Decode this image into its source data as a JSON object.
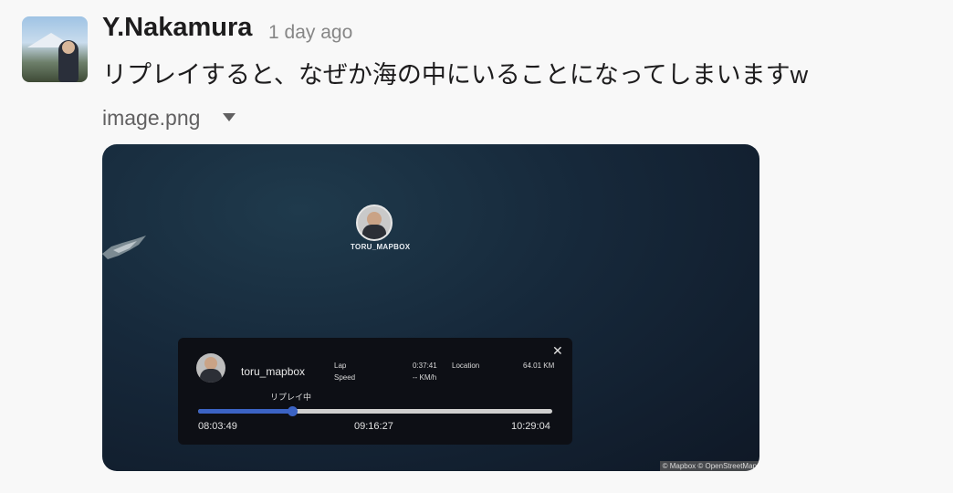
{
  "message": {
    "author": "Y.Nakamura",
    "timestamp": "1 day ago",
    "text": "リプレイすると、なぜか海の中にいることになってしまいますw",
    "attachment_name": "image.png"
  },
  "map": {
    "marker_label": "TORU_MAPBOX",
    "attribution": "© Mapbox © OpenStreetMap"
  },
  "replay_panel": {
    "username": "toru_mapbox",
    "lap_label": "Lap",
    "lap_value": "0:37:41",
    "location_label": "Location",
    "location_value": "64.01 KM",
    "speed_label": "Speed",
    "speed_value": "-- KM/h",
    "status": "リプレイ中",
    "start_time": "08:03:49",
    "current_time": "09:16:27",
    "end_time": "10:29:04",
    "progress": 0.265,
    "close_icon": "close-icon",
    "accent_color": "#3b63c4"
  }
}
